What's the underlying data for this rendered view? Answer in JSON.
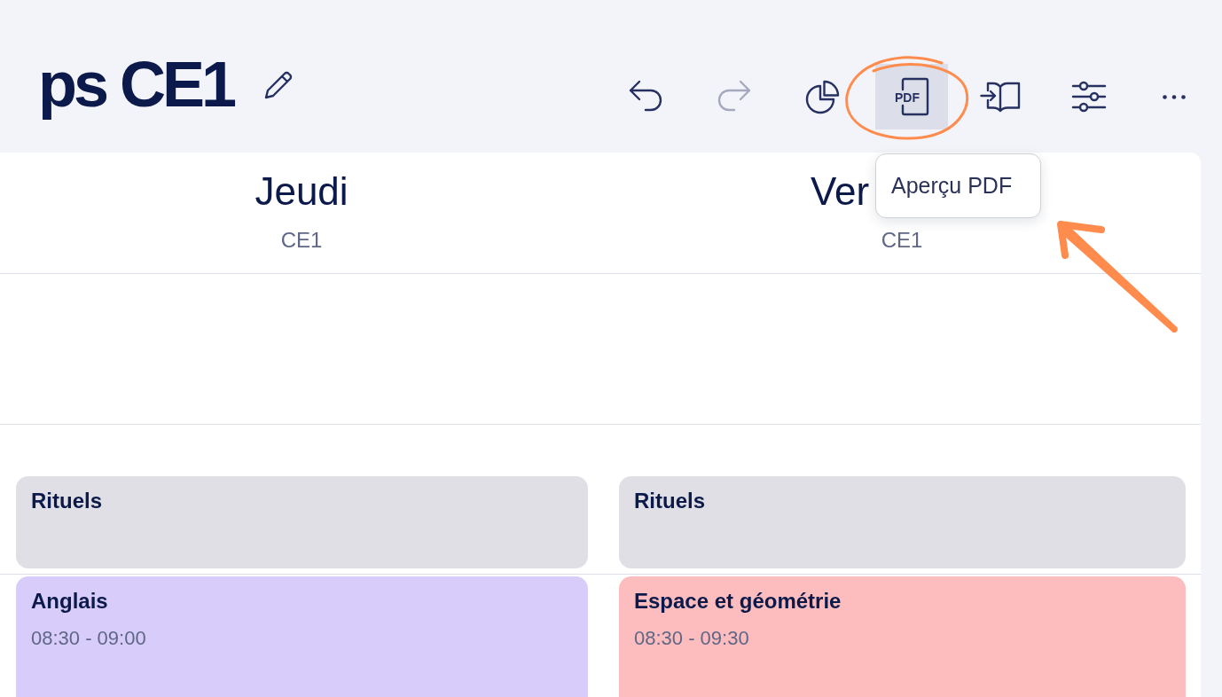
{
  "header": {
    "title": "ps CE1"
  },
  "toolbar": {
    "tools": [
      {
        "disabled": false,
        "hovered": false
      },
      {
        "disabled": true,
        "hovered": false
      },
      {
        "disabled": false,
        "hovered": false
      },
      {
        "label": "PDF",
        "tooltip": "Aperçu PDF",
        "disabled": false,
        "hovered": true
      },
      {
        "disabled": false,
        "hovered": false
      },
      {
        "disabled": false,
        "hovered": false
      },
      {
        "disabled": false,
        "hovered": false
      }
    ]
  },
  "calendar": {
    "days": [
      {
        "name": "Jeudi",
        "subtitle": "CE1",
        "events": [
          {
            "title": "Rituels",
            "color": "#e0dfe5"
          },
          {
            "title": "Anglais",
            "time": "08:30 - 09:00",
            "color": "#d8ccfb"
          }
        ]
      },
      {
        "name": "Ver",
        "subtitle": "CE1",
        "events": [
          {
            "title": "Rituels",
            "color": "#e0dfe5"
          },
          {
            "title": "Espace et géométrie",
            "time": "08:30 - 09:30",
            "color": "#fdbcbd"
          }
        ]
      }
    ]
  },
  "annotations": {
    "highlight_ellipse": true,
    "pointer_arrow": true
  }
}
